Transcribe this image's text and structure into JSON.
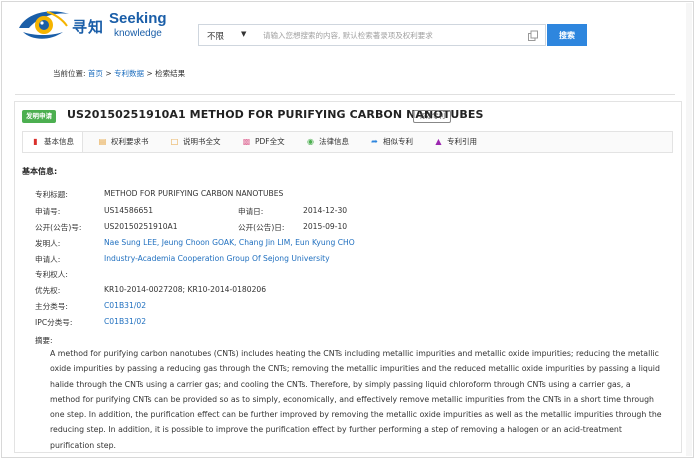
{
  "header": {
    "logo_cn": "寻知",
    "logo_en_main": "Seeking",
    "logo_en_sub": "knowledge",
    "search_scope": "不限",
    "search_placeholder": "请输入您想搜索的内容, 默认检索著录项及权利要求",
    "search_button": "搜索"
  },
  "breadcrumb": {
    "prefix": "当前位置:",
    "home": "首页",
    "sep1": ">",
    "patent_data": "专利数据",
    "sep2": ">",
    "current": "检索结果"
  },
  "patent": {
    "status_badge": "发明申请",
    "title": "US20150251910A1  METHOD FOR PURIFYING CARBON NANOTUBES",
    "valid_tag": "有效专利"
  },
  "tabs": [
    {
      "label": "基本信息",
      "icon": "bookmark-icon"
    },
    {
      "label": "权利要求书",
      "icon": "document-icon"
    },
    {
      "label": "说明书全文",
      "icon": "document-icon"
    },
    {
      "label": "PDF全文",
      "icon": "pdf-icon"
    },
    {
      "label": "法律信息",
      "icon": "legal-icon"
    },
    {
      "label": "相似专利",
      "icon": "share-icon"
    },
    {
      "label": "专利引用",
      "icon": "org-chart-icon"
    }
  ],
  "section_title": "基本信息:",
  "fields": {
    "title_label": "专利标题:",
    "title_value": "METHOD FOR PURIFYING CARBON NANOTUBES",
    "app_no_label": "申请号:",
    "app_no_value": "US14586651",
    "app_date_label": "申请日:",
    "app_date_value": "2014-12-30",
    "pub_no_label": "公开(公告)号:",
    "pub_no_value": "US20150251910A1",
    "pub_date_label": "公开(公告)日:",
    "pub_date_value": "2015-09-10",
    "inventor_label": "发明人:",
    "inventor_value": "Nae Sung LEE, Jeung Choon GOAK, Chang Jin LIM, Eun Kyung CHO",
    "applicant_label": "申请人:",
    "applicant_value": "Industry-Academia Cooperation Group Of Sejong University",
    "holder_label": "专利权人:",
    "priority_label": "优先权:",
    "priority_value": "KR10-2014-0027208; KR10-2014-0180206",
    "main_class_label": "主分类号:",
    "main_class_value": "C01B31/02",
    "ipc_label": "IPC分类号:",
    "ipc_value": "C01B31/02"
  },
  "abstract": {
    "label": "摘要:",
    "text": "A method for purifying carbon nanotubes (CNTs) includes heating the CNTs including metallic impurities and metallic oxide impurities; reducing the metallic oxide impurities by passing a reducing gas through the CNTs; removing the metallic impurities and the reduced metallic oxide impurities by passing a liquid halide through the CNTs using a carrier gas; and cooling the CNTs. Therefore, by simply passing liquid chloroform through CNTs using a carrier gas, a method for purifying CNTs can be provided so as to simply, economically, and effectively remove metallic impurities from the CNTs in a short time through one step. In addition, the purification effect can be further improved by removing the metallic oxide impurities as well as the metallic impurities through the reducing step. In addition, it is possible to improve the purification effect by further performing a step of removing a halogen or an acid-treatment purification step."
  },
  "colors": {
    "brand_blue": "#1a5ea8",
    "link_blue": "#1f6fbf",
    "search_button": "#2e86de",
    "status_green": "#4caf50"
  }
}
